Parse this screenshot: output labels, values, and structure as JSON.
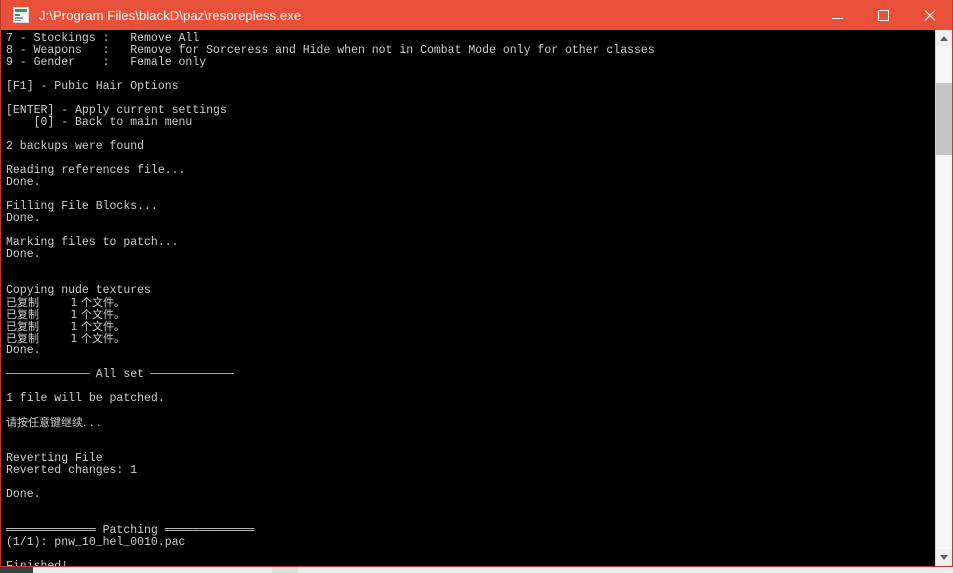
{
  "window": {
    "title": "J:\\Program Files\\blackD\\paz\\resorepless.exe",
    "icon": "console-app-icon",
    "accent_color": "#e8503a",
    "body_background": "#000000",
    "text_color": "#cccccc",
    "controls": {
      "minimize_label": "Minimize",
      "maximize_label": "Maximize",
      "close_label": "Close"
    }
  },
  "scrollbar": {
    "up_arrow_label": "Scroll up",
    "down_arrow_label": "Scroll down",
    "thumb_label": "Scroll thumb"
  },
  "console": {
    "lines": [
      "7 - Stockings :   Remove All",
      "8 - Weapons   :   Remove for Sorceress and Hide when not in Combat Mode only for other classes",
      "9 - Gender    :   Female only",
      "",
      "[F1] - Pubic Hair Options",
      "",
      "[ENTER] - Apply current settings",
      "    [0] - Back to main menu",
      "",
      "2 backups were found",
      "",
      "Reading references file...",
      "Done.",
      "",
      "Filling File Blocks...",
      "Done.",
      "",
      "Marking files to patch...",
      "Done.",
      "",
      "",
      "Copying nude textures",
      "已复制         1 个文件。",
      "已复制         1 个文件。",
      "已复制         1 个文件。",
      "已复制         1 个文件。",
      "Done.",
      "",
      "──────────── All set ────────────",
      "",
      "1 file will be patched.",
      "",
      "请按任意键继续. . .",
      "",
      "",
      "Reverting File",
      "Reverted changes: 1",
      "",
      "Done.",
      "",
      "",
      "═════════════ Patching ═════════════",
      "(1/1): pnw_10_hel_0010.pac",
      "",
      "Finished!"
    ],
    "cjk_line_indices": [
      22,
      23,
      24,
      25,
      32
    ]
  }
}
